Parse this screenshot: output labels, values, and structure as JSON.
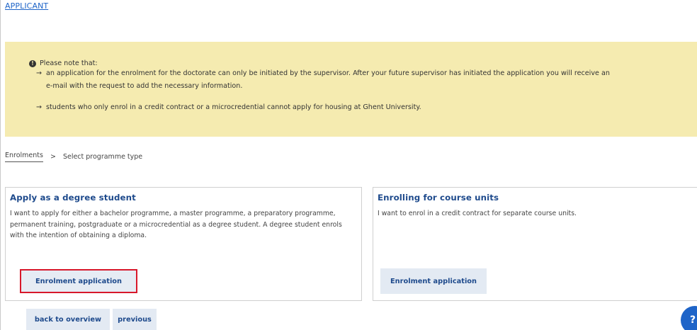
{
  "header": {
    "applicant_link": "APPLICANT"
  },
  "notice": {
    "title": "Please note that:",
    "bullet_arrow": "→",
    "items": [
      {
        "line1": "an application for the enrolment for the doctorate can only be initiated by the supervisor. After your future supervisor has initiated the application you will receive an",
        "line2": "e-mail with the request to add the necessary information."
      },
      {
        "line1": "students who only enrol in a credit contract or a microcredential cannot apply for housing at Ghent University."
      }
    ]
  },
  "breadcrumb": {
    "root": "Enrolments",
    "separator": ">",
    "current": "Select programme type"
  },
  "cards": [
    {
      "title": "Apply as a degree student",
      "description": "I want to apply for either a bachelor programme, a master programme, a preparatory programme, permanent training, postgraduate or a microcredential as a degree student. A degree student enrols with the intention of obtaining a diploma.",
      "button_label": "Enrolment application"
    },
    {
      "title": "Enrolling for course units",
      "description": "I want to enrol in a credit contract for separate course units.",
      "button_label": "Enrolment application"
    }
  ],
  "footer": {
    "back_label": "back to overview",
    "previous_label": "previous",
    "help_label": "?"
  },
  "colors": {
    "notice_bg": "#f5ebb0",
    "link_blue": "#1e64c8",
    "title_blue": "#1e4a8c",
    "button_bg": "#e3eaf3",
    "highlight_red": "#d8182b"
  }
}
